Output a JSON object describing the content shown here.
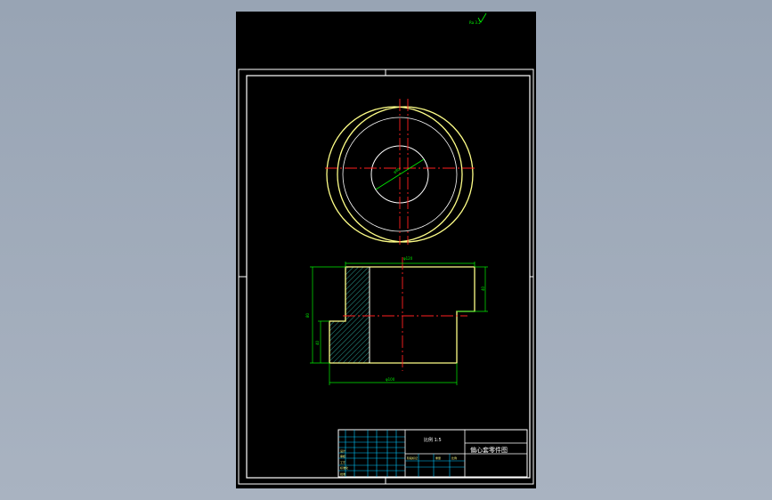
{
  "colors": {
    "background": "#9aa6b6",
    "paper": "#000000",
    "frame": "#ffffff",
    "part_outline": "#ffff88",
    "centerline": "#ff2020",
    "dimension": "#00ee00",
    "hatch": "#3fe0d0",
    "roughness": "#00ff00"
  },
  "drawing": {
    "roughness_mark": "Ra 3.2",
    "top_view_dim": "φ80",
    "front_view": {
      "dim_top": "φ120",
      "dim_bottom": "φ100",
      "dim_height_total": "80",
      "dim_height_lower": "40",
      "dim_height_right": "40"
    }
  },
  "title_block": {
    "scale_text": "比例 1:5",
    "drawing_title": "偏心套零件图",
    "cells": [
      "设计",
      "审核",
      "工艺",
      "标准化",
      "批准",
      "阶段标记",
      "重量",
      "比例"
    ]
  }
}
